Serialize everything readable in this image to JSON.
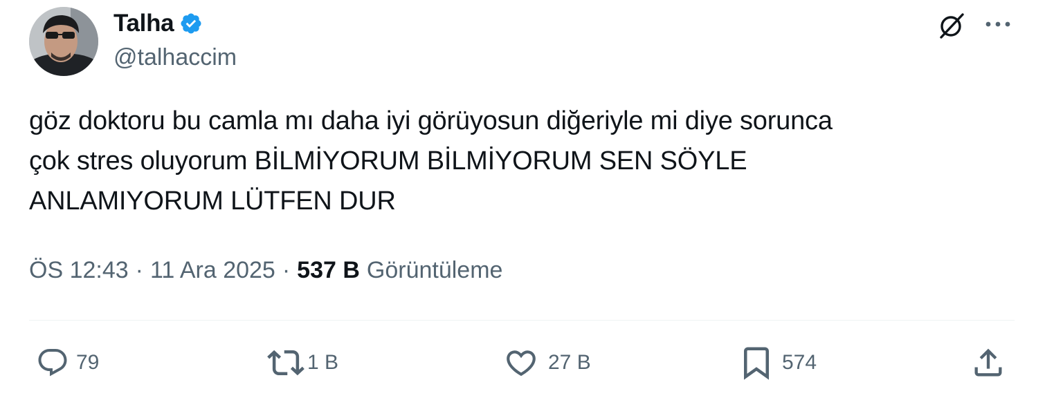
{
  "author": {
    "display_name": "Talha",
    "handle": "@talhaccim",
    "verified_color": "#1d9bf0"
  },
  "tweet": {
    "lines": [
      "göz doktoru bu camla mı daha iyi görüyosun diğeriyle mi diye sorunca",
      "çok stres oluyorum BİLMİYORUM BİLMİYORUM SEN SÖYLE",
      "ANLAMIYORUM LÜTFEN DUR"
    ]
  },
  "meta": {
    "time": "ÖS 12:43",
    "separator": "·",
    "date": "11 Ara 2025",
    "views_count": "537 B",
    "views_label": "Görüntüleme"
  },
  "actions": {
    "reply": {
      "icon": "reply-icon",
      "count": "79"
    },
    "retweet": {
      "icon": "retweet-icon",
      "count": "1 B"
    },
    "like": {
      "icon": "heart-icon",
      "count": "27 B"
    },
    "bookmark": {
      "icon": "bookmark-icon",
      "count": "574"
    },
    "share": {
      "icon": "share-icon"
    }
  },
  "header_icons": {
    "grok": "grok-icon",
    "more": "more-icon"
  },
  "colors": {
    "text_primary": "#0f1419",
    "text_secondary": "#536471",
    "divider": "#eff3f4"
  }
}
